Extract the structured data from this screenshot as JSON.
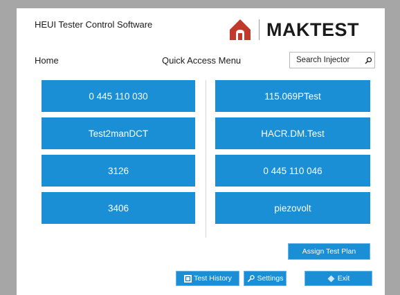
{
  "header": {
    "app_title": "HEUI Tester Control Software",
    "brand_name": "MAKTEST",
    "brand_color": "#c0392b"
  },
  "nav": {
    "home_label": "Home",
    "quick_access_label": "Quick Access Menu",
    "search_placeholder": "Search Injector"
  },
  "quick_access": {
    "left": [
      "0 445 110 030",
      "Test2manDCT",
      "3126",
      "3406"
    ],
    "right": [
      "115.069PTest",
      "HACR.DM.Test",
      "0 445 110 046",
      "piezovolt"
    ]
  },
  "actions": {
    "assign_label": "Assign Test Plan",
    "history_label": "Test History",
    "settings_label": "Settings",
    "exit_label": "Exit"
  },
  "colors": {
    "tile_blue": "#1a8fd6",
    "background_gray": "#a6a6a6"
  }
}
